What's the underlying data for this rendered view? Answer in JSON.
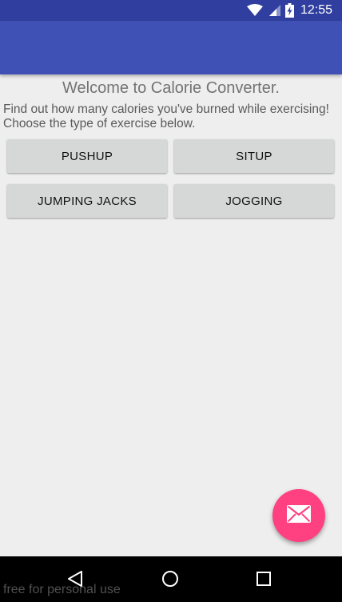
{
  "status_bar": {
    "time": "12:55",
    "icons": [
      "wifi-icon",
      "cell-signal-icon",
      "battery-charging-icon"
    ]
  },
  "main": {
    "welcome": "Welcome to Calorie Converter.",
    "description": "Find out how many calories you've burned while exercising! Choose the type of exercise below.",
    "buttons": {
      "pushup": "PUSHUP",
      "situp": "SITUP",
      "jumping_jacks": "JUMPING JACKS",
      "jogging": "JOGGING"
    }
  },
  "fab": {
    "icon": "mail-icon"
  },
  "nav_bar": {
    "icons": [
      "back-icon",
      "home-icon",
      "recents-icon"
    ]
  },
  "watermark": "free for personal use",
  "colors": {
    "status_bar": "#303F9F",
    "toolbar": "#3F51B5",
    "accent": "#FF4081",
    "background": "#EEEEEE",
    "button": "#D6D7D7"
  }
}
